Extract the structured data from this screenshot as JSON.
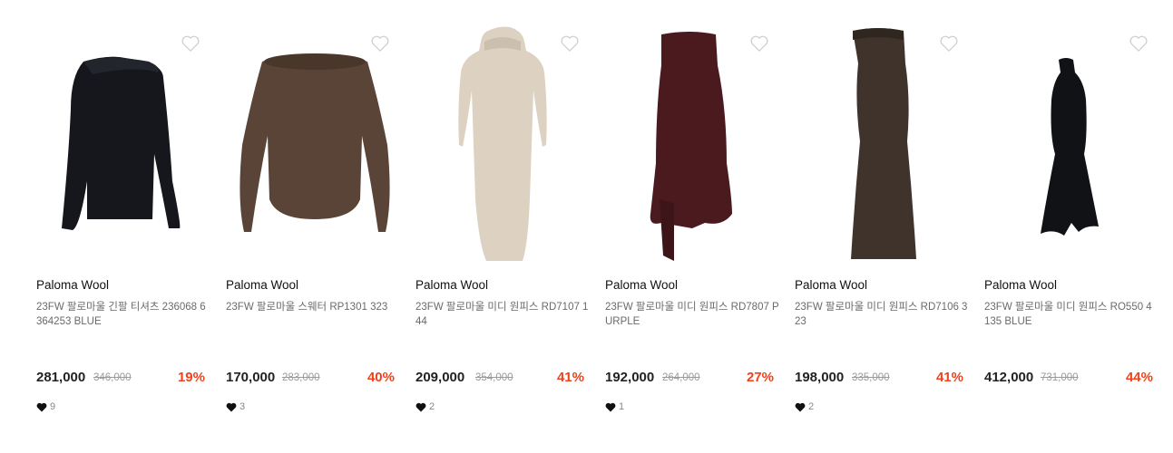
{
  "products": [
    {
      "brand": "Paloma Wool",
      "name": "23FW 팔로마울 긴팔 티셔츠 236068 6364253 BLUE",
      "price": "281,000",
      "original_price": "346,000",
      "discount": "19%",
      "likes": "9"
    },
    {
      "brand": "Paloma Wool",
      "name": "23FW 팔로마울 스웨터 RP1301 323",
      "price": "170,000",
      "original_price": "283,000",
      "discount": "40%",
      "likes": "3"
    },
    {
      "brand": "Paloma Wool",
      "name": "23FW 팔로마울 미디 원피스 RD7107 144",
      "price": "209,000",
      "original_price": "354,000",
      "discount": "41%",
      "likes": "2"
    },
    {
      "brand": "Paloma Wool",
      "name": "23FW 팔로마울 미디 원피스 RD7807 PURPLE",
      "price": "192,000",
      "original_price": "264,000",
      "discount": "27%",
      "likes": "1"
    },
    {
      "brand": "Paloma Wool",
      "name": "23FW 팔로마울 미디 원피스 RD7106 323",
      "price": "198,000",
      "original_price": "335,000",
      "discount": "41%",
      "likes": "2"
    },
    {
      "brand": "Paloma Wool",
      "name": "23FW 팔로마울 미디 원피스 RO550 4 135 BLUE",
      "price": "412,000",
      "original_price": "731,000",
      "discount": "44%",
      "likes": ""
    }
  ],
  "icons": {
    "wishlist": "heart-outline-icon",
    "likes": "heart-filled-icon"
  },
  "colors": {
    "discount": "#f0421c",
    "price": "#222222",
    "brand": "#111111",
    "name": "#6a6a6a",
    "original_price": "#9a9a9a"
  }
}
